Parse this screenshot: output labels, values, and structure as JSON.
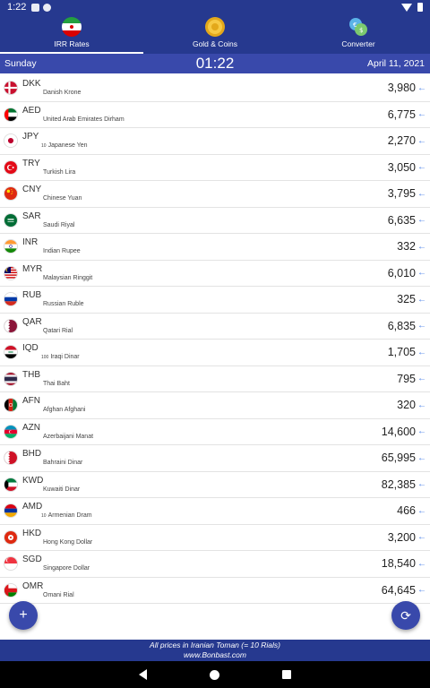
{
  "status": {
    "time": "1:22"
  },
  "tabs": [
    {
      "label": "IRR Rates",
      "icon": "iran-flag-icon",
      "active": true
    },
    {
      "label": "Gold & Coins",
      "icon": "gold-coin-icon",
      "active": false
    },
    {
      "label": "Converter",
      "icon": "currency-exchange-icon",
      "active": false
    }
  ],
  "datebar": {
    "day": "Sunday",
    "time": "01:22",
    "date": "April 11, 2021"
  },
  "rows": [
    {
      "code": "DKK",
      "mult": "",
      "name": "Danish Krone",
      "value": "3,980"
    },
    {
      "code": "AED",
      "mult": "",
      "name": "United Arab Emirates Dirham",
      "value": "6,775"
    },
    {
      "code": "JPY",
      "mult": "10",
      "name": "Japanese Yen",
      "value": "2,270"
    },
    {
      "code": "TRY",
      "mult": "",
      "name": "Turkish Lira",
      "value": "3,050"
    },
    {
      "code": "CNY",
      "mult": "",
      "name": "Chinese Yuan",
      "value": "3,795"
    },
    {
      "code": "SAR",
      "mult": "",
      "name": "Saudi Riyal",
      "value": "6,635"
    },
    {
      "code": "INR",
      "mult": "",
      "name": "Indian Rupee",
      "value": "332"
    },
    {
      "code": "MYR",
      "mult": "",
      "name": "Malaysian Ringgit",
      "value": "6,010"
    },
    {
      "code": "RUB",
      "mult": "",
      "name": "Russian Ruble",
      "value": "325"
    },
    {
      "code": "QAR",
      "mult": "",
      "name": "Qatari Rial",
      "value": "6,835"
    },
    {
      "code": "IQD",
      "mult": "100",
      "name": "Iraqi Dinar",
      "value": "1,705"
    },
    {
      "code": "THB",
      "mult": "",
      "name": "Thai Baht",
      "value": "795"
    },
    {
      "code": "AFN",
      "mult": "",
      "name": "Afghan Afghani",
      "value": "320"
    },
    {
      "code": "AZN",
      "mult": "",
      "name": "Azerbaijani Manat",
      "value": "14,600"
    },
    {
      "code": "BHD",
      "mult": "",
      "name": "Bahraini Dinar",
      "value": "65,995"
    },
    {
      "code": "KWD",
      "mult": "",
      "name": "Kuwaiti Dinar",
      "value": "82,385"
    },
    {
      "code": "AMD",
      "mult": "10",
      "name": "Armenian Dram",
      "value": "466"
    },
    {
      "code": "HKD",
      "mult": "",
      "name": "Hong Kong Dollar",
      "value": "3,200"
    },
    {
      "code": "SGD",
      "mult": "",
      "name": "Singapore Dollar",
      "value": "18,540"
    },
    {
      "code": "OMR",
      "mult": "",
      "name": "Omani Rial",
      "value": "64,645"
    }
  ],
  "fabs": {
    "add": "+",
    "refresh": "⟳"
  },
  "footer": {
    "line1": "All prices in Iranian Toman (= 10 Rials)",
    "line2": "www.Bonbast.com"
  },
  "colors": {
    "primary": "#26398f",
    "datebar": "#3949ab",
    "arrow": "#4a80e8"
  }
}
